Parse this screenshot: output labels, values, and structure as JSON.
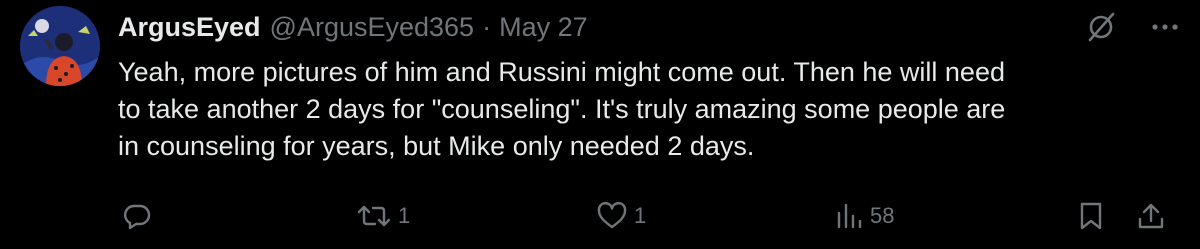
{
  "tweet": {
    "display_name": "ArgusEyed",
    "handle": "@ArgusEyed365",
    "separator": "·",
    "date": "May 27",
    "text_lines": [
      "Yeah, more pictures of him and Russini might come out. Then he will need",
      "to take another 2 days for \"counseling\". It's truly amazing some people are",
      "in counseling for years, but Mike only needed 2 days."
    ],
    "header_icons": [
      "grok-icon",
      "more-icon"
    ]
  },
  "actions": {
    "reply": {
      "icon": "reply-icon",
      "count": ""
    },
    "repost": {
      "icon": "repost-icon",
      "count": "1"
    },
    "like": {
      "icon": "heart-icon",
      "count": "1"
    },
    "views": {
      "icon": "views-icon",
      "count": "58"
    },
    "bookmark": {
      "icon": "bookmark-icon"
    },
    "share": {
      "icon": "share-icon"
    }
  },
  "colors": {
    "background": "#000000",
    "text": "#e7e9ea",
    "secondary": "#71767b"
  }
}
